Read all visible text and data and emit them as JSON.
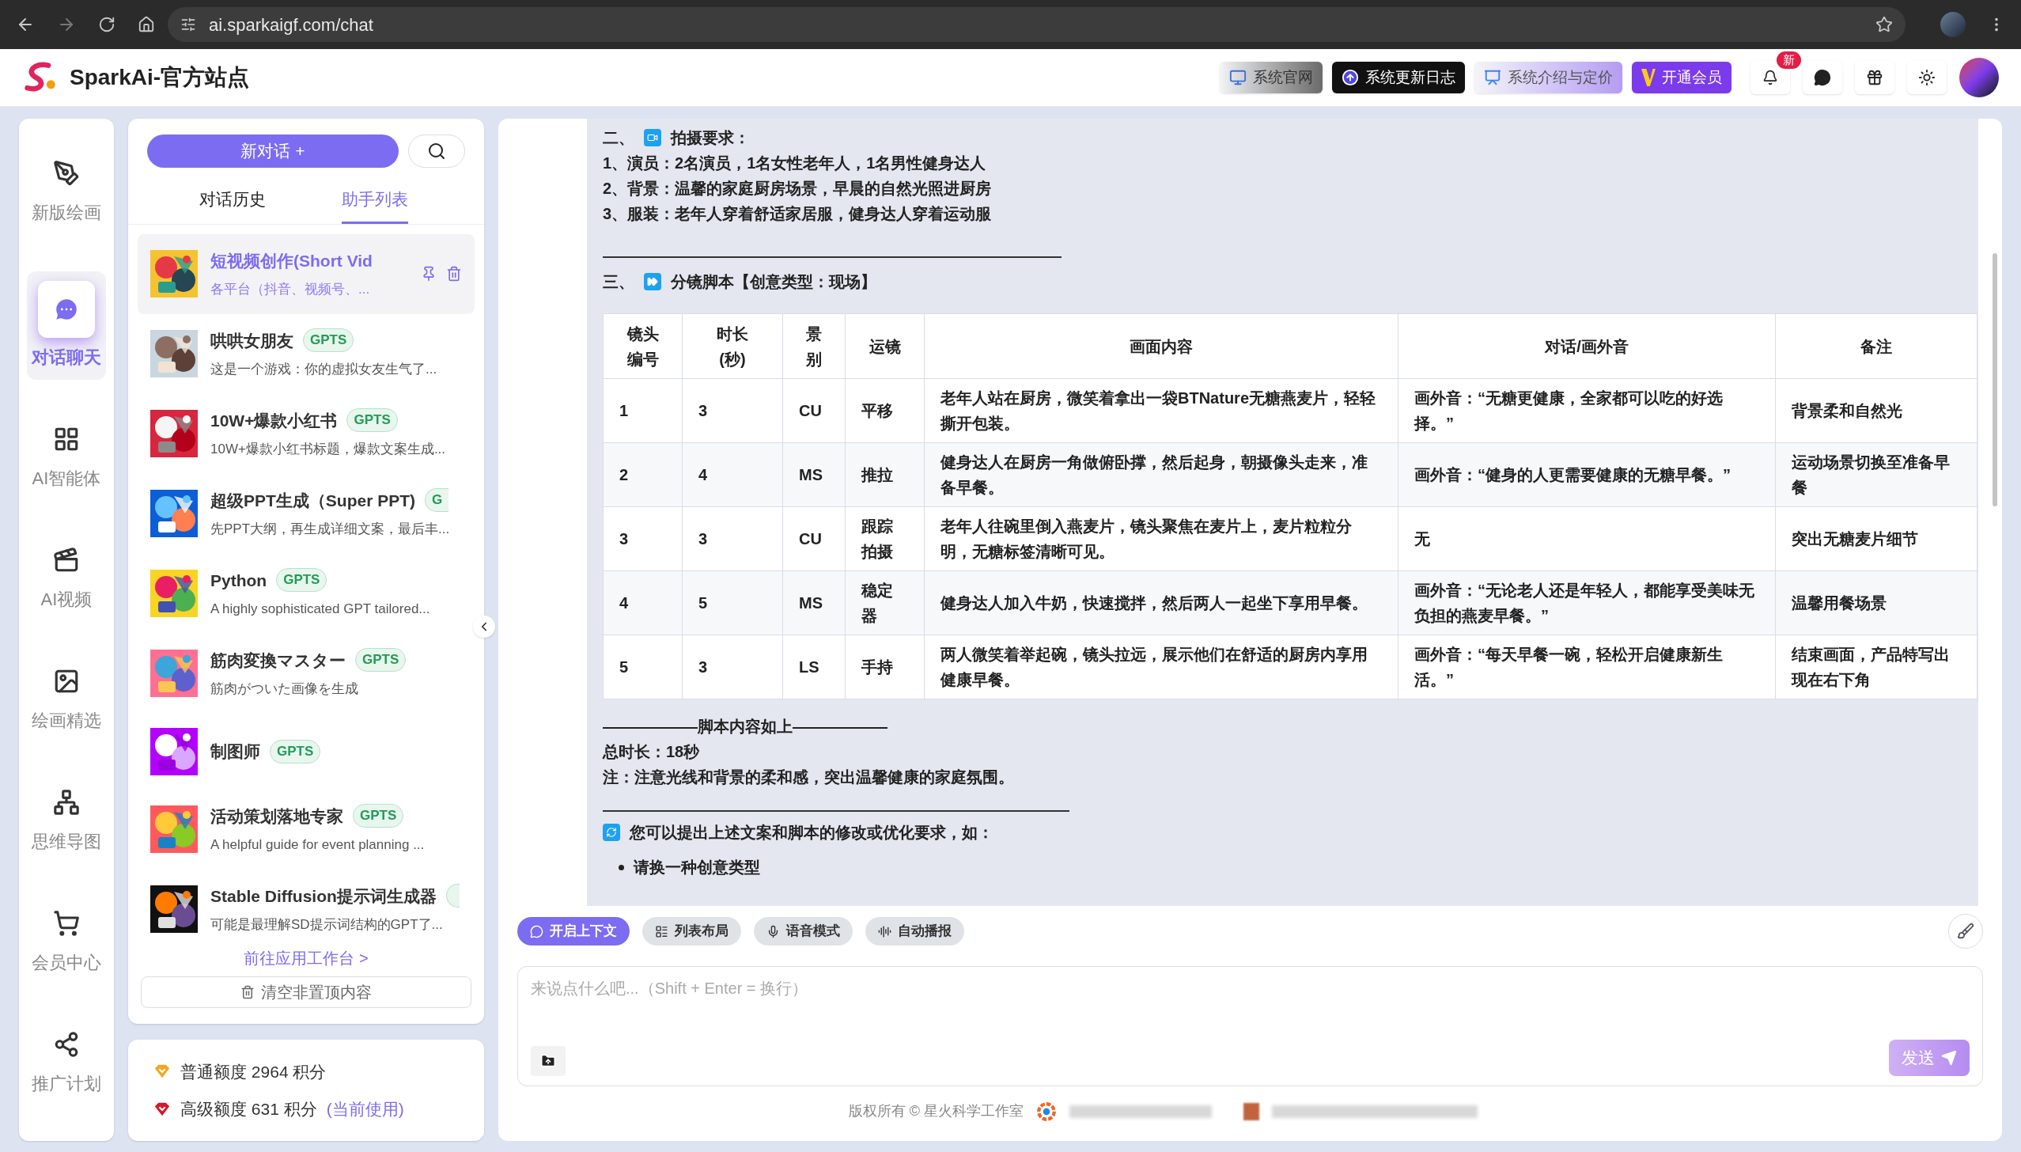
{
  "browser": {
    "url": "ai.sparkaigf.com/chat"
  },
  "header": {
    "site_title": "SparkAi-官方站点",
    "buttons": [
      {
        "label": "系统官网",
        "kind": "site"
      },
      {
        "label": "系统更新日志",
        "kind": "log"
      },
      {
        "label": "系统介绍与定价",
        "kind": "pricing"
      },
      {
        "label": "开通会员",
        "kind": "vip"
      }
    ],
    "notification_badge": "新"
  },
  "nav": {
    "items": [
      {
        "label": "新版绘画",
        "kind": "draw",
        "selected": false
      },
      {
        "label": "对话聊天",
        "kind": "chat",
        "selected": true
      },
      {
        "label": "AI智能体",
        "kind": "agents",
        "selected": false
      },
      {
        "label": "AI视频",
        "kind": "video",
        "selected": false
      },
      {
        "label": "绘画精选",
        "kind": "gallery",
        "selected": false
      },
      {
        "label": "思维导图",
        "kind": "mindmap",
        "selected": false
      },
      {
        "label": "会员中心",
        "kind": "cart",
        "selected": false
      },
      {
        "label": "推广计划",
        "kind": "share",
        "selected": false
      }
    ]
  },
  "assistant_panel": {
    "new_chat": "新对话 +",
    "tabs": [
      {
        "label": "对话历史",
        "selected": false
      },
      {
        "label": "助手列表",
        "selected": true
      }
    ],
    "assistants": [
      {
        "title": "短视频创作(Short Vid",
        "description": "各平台（抖音、视频号、...",
        "selected": true
      },
      {
        "title": "哄哄女朋友",
        "tag": "GPTS",
        "description": "这是一个游戏：你的虚拟女友生气了...",
        "selected": false
      },
      {
        "title": "10W+爆款小红书",
        "tag": "GPTS",
        "description": "10W+爆款小红书标题，爆款文案生成...",
        "selected": false
      },
      {
        "title": "超级PPT生成（Super PPT)",
        "tag": "G",
        "tag_clipped": true,
        "description": "先PPT大纲，再生成详细文案，最后丰...",
        "selected": false
      },
      {
        "title": "Python",
        "tag": "GPTS",
        "description": "A highly sophisticated GPT tailored...",
        "selected": false
      },
      {
        "title": "筋肉変換マスター",
        "tag": "GPTS",
        "description": "筋肉がついた画像を生成",
        "selected": false
      },
      {
        "title": "制图师",
        "tag": "GPTS",
        "selected": false
      },
      {
        "title": "活动策划落地专家",
        "tag": "GPTS",
        "description": "A helpful guide for event planning ...",
        "selected": false
      },
      {
        "title": "Stable Diffusion提示词生成器",
        "tag_clipped": true,
        "description": "可能是最理解SD提示词结构的GPT了...",
        "selected": false
      }
    ],
    "workspace_link": "前往应用工作台 >",
    "clear_button": "清空非置顶内容"
  },
  "credits": [
    {
      "label": "普通额度",
      "amount": "2964",
      "unit": "积分",
      "color": "#f5a623"
    },
    {
      "label": "高级额度",
      "amount": "631",
      "unit": "积分",
      "note": "(当前使用)",
      "color": "#d0192b"
    }
  ],
  "message": {
    "section2_heading": "二、",
    "section2_title": "拍摄要求：",
    "section2_lines": [
      "1、演员：2名演员，1名女性老年人，1名男性健身达人",
      "2、背景：温馨的家庭厨房场景，早晨的自然光照进厨房",
      "3、服装：老年人穿着舒适家居服，健身达人穿着运动服"
    ],
    "section3_heading": "三、",
    "section3_title": "分镜脚本【创意类型：现场】",
    "table": {
      "columns": [
        "镜头编号",
        "时长(秒)",
        "景别",
        "运镜",
        "画面内容",
        "对话/画外音",
        "备注"
      ],
      "rows": [
        [
          "1",
          "3",
          "CU",
          "平移",
          "老年人站在厨房，微笑着拿出一袋BTNature无糖燕麦片，轻轻撕开包装。",
          "画外音：“无糖更健康，全家都可以吃的好选择。”",
          "背景柔和自然光"
        ],
        [
          "2",
          "4",
          "MS",
          "推拉",
          "健身达人在厨房一角做俯卧撑，然后起身，朝摄像头走来，准备早餐。",
          "画外音：“健身的人更需要健康的无糖早餐。”",
          "运动场景切换至准备早餐"
        ],
        [
          "3",
          "3",
          "CU",
          "跟踪拍摄",
          "老年人往碗里倒入燕麦片，镜头聚焦在麦片上，麦片粒粒分明，无糖标签清晰可见。",
          "无",
          "突出无糖麦片细节"
        ],
        [
          "4",
          "5",
          "MS",
          "稳定器",
          "健身达人加入牛奶，快速搅拌，然后两人一起坐下享用早餐。",
          "画外音：“无论老人还是年轻人，都能享受美味无负担的燕麦早餐。”",
          "温馨用餐场景"
        ],
        [
          "5",
          "3",
          "LS",
          "手持",
          "两人微笑着举起碗，镜头拉远，展示他们在舒适的厨房内享用健康早餐。",
          "画外音：“每天早餐一碗，轻松开启健康新生活。”",
          "结束画面，产品特写出现在右下角"
        ]
      ]
    },
    "end_line": "——————脚本内容如上——————",
    "total": "总时长：18秒",
    "note": "注：注意光线和背景的柔和感，突出温馨健康的家庭氛围。",
    "prompt": "您可以提出上述文案和脚本的修改或优化要求，如：",
    "bullets": [
      "请换一种创意类型"
    ]
  },
  "toolbar": {
    "buttons": [
      {
        "label": "开启上下文",
        "kind": "context",
        "selected": true
      },
      {
        "label": "列表布局",
        "kind": "layout",
        "selected": false
      },
      {
        "label": "语音模式",
        "kind": "voice",
        "selected": false
      },
      {
        "label": "自动播报",
        "kind": "auto",
        "selected": false
      }
    ]
  },
  "input": {
    "placeholder": "来说点什么吧...（Shift + Enter = 换行）",
    "send": "发送"
  },
  "footer": {
    "copyright": "版权所有 © 星火科学工作室"
  }
}
